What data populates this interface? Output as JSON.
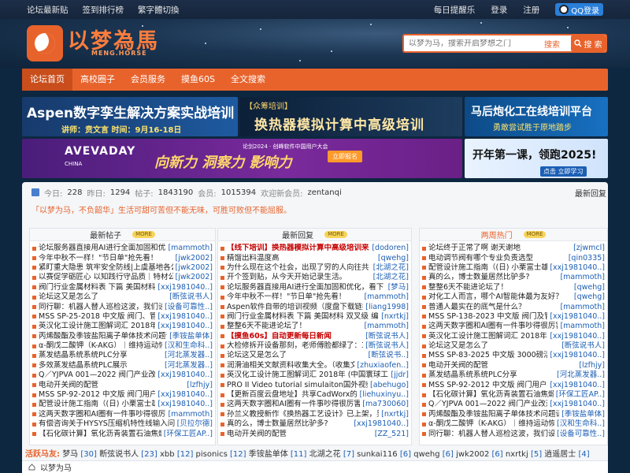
{
  "topbar": {
    "links": [
      "论坛最新贴",
      "签到排行榜",
      "繁字體切換"
    ],
    "daily": "每日提醒乐",
    "login": "登录",
    "register": "注册",
    "qq_login": "QQ登录"
  },
  "logo": {
    "title": "以梦為馬",
    "subtitle": "MENG.HORSE"
  },
  "search": {
    "placeholder": "以梦为马，搜索开启梦想之门",
    "label": "搜索",
    "button": "搜 索"
  },
  "nav": [
    "论坛首页",
    "高校圈子",
    "会员服务",
    "摸鱼60S",
    "全文搜索"
  ],
  "banners": {
    "b1_title": "Aspen数字孪生解决方案实战培训",
    "b1_sub": "讲师：贲文言    时间：9月16-18日",
    "b2_tag": "【众筹培训】",
    "b2_title": "换热器模拟计算中高级培训",
    "b3_title": "马后炮化工在线培训平台",
    "b3_sub": "勇敢尝试胜于原地踏步",
    "b4_brand": "AVEVADAY",
    "b4_brand_sub": "CHINA",
    "b4_event": "论剑2024 · 创峰软件中国用户大会",
    "b4_slogan": "向新力 洞察力 影响力",
    "b4_cta": "立即报名",
    "b5_title": "开年第一课，领跑2025!",
    "b5_cta": "点击 立即学习"
  },
  "stats": {
    "today_label": "今日:",
    "today": "228",
    "yesterday_label": "昨日:",
    "yesterday": "1294",
    "posts_label": "帖子:",
    "posts": "1843190",
    "members_label": "会员:",
    "members": "1015394",
    "welcome_label": "欢迎新会员:",
    "newest": "zentanqi",
    "latest_reply": "最新回复"
  },
  "slogan": "「以梦为马，不负韶华」生活可甜可苦但不能无味，可胜可败但不能屈服。",
  "more_label": "MORE",
  "col_latest": {
    "head": "最新帖子",
    "rows": [
      {
        "t": "论坛服务器直接用AI进行全面加固和优化，",
        "a": "[mammoth]"
      },
      {
        "t": "今年中秋不一样！\"节日单\"抢先看！",
        "a": "[jwk2002]"
      },
      {
        "t": "紧盯重大隐患 筑牢安全防线|上虞基地各公司",
        "a": "[jwk2002]"
      },
      {
        "t": "以赛促学砺匠心 以知践行守品质｜特材公司",
        "a": "[jwk2002]"
      },
      {
        "t": "阀门行业金属材料表 下篇 美国材料 双叉 双",
        "a": "[xxj1981040..]"
      },
      {
        "t": "论坛这又是怎么了",
        "a": "[断弦说书人]"
      },
      {
        "t": "同行聊：机器人替人巡检这波，我们设备",
        "a": "[设备可靠性..]"
      },
      {
        "t": "MSS SP-25-2018 中文版 阀门、管件、",
        "a": "[xxj1981040..]"
      },
      {
        "t": "英汉化工设计施工图解词汇 2018年 (中国",
        "a": "[xxj1981040..]"
      },
      {
        "t": "丙烯酸酯及季铵盐阳离子单体技术问题请",
        "a": "[季铵盐单体]"
      },
      {
        "t": "α-酮戊二酸钾（K-AKG）｜维持运动恢复",
        "a": "[汉和生命科..]"
      },
      {
        "t": "蒸发结晶系统系统PLC分享",
        "a": "[河北蒸发器..]"
      },
      {
        "t": "多效蒸发结晶系统PLC展示",
        "a": "[河北蒸发器..]"
      },
      {
        "t": "Q／YJPVA 001—2022 阀门产业改造提",
        "a": "[xxj1981040..]"
      },
      {
        "t": "电动开关阀的配管",
        "a": "[lzfhjy]"
      },
      {
        "t": "MSS SP-92-2012 中文版 阀门用户指南",
        "a": "[xxj1981040..]"
      },
      {
        "t": "配管设计施工指南（(日) 小栗富士雄",
        "a": "[xxj1981040..]"
      },
      {
        "t": "这两天数字圈和AI圈有一件事吵得很厉害",
        "a": "[mammoth]"
      },
      {
        "t": "有偿咨询关于HYSYS压缩机特性线输入问题",
        "a": "[贝拉尔德]"
      },
      {
        "t": "【石化碳计算】氧化沥青装置石油焦煅烧",
        "a": "[环保工匠AP..]"
      }
    ]
  },
  "col_reply": {
    "head": "最新回复",
    "rows": [
      {
        "t": "【线下培训】换热器模拟计算中高级培训来了",
        "a": "[dodoren]",
        "hl": true
      },
      {
        "t": "精馏出料温度高",
        "a": "[qwehg]"
      },
      {
        "t": "为什么现在这个社会，出现了穷的人向往共",
        "a": "[北湖之花]"
      },
      {
        "t": "开个签到贴，从今天开始记录生活。",
        "a": "[北湖之花]"
      },
      {
        "t": "论坛服务器直接用AI进行全面加固和优化，看下",
        "a": "[梦马]"
      },
      {
        "t": "今年中秋不一样！\"节日单\"抢先看！",
        "a": "[mammoth]"
      },
      {
        "t": "Aspen软件自带的培训视频（度盘下载链接",
        "a": "[liang1998]"
      },
      {
        "t": "阀门行业金属材料表 下篇 美国材料 双叉级 编制",
        "a": "[nxrtkj]"
      },
      {
        "t": "整整6天不能进论坛了！",
        "a": "[mammoth]"
      },
      {
        "t": "【摸鱼60s】自动更新每日新闻",
        "a": "[断弦说书人]",
        "hl": true
      },
      {
        "t": "大检修拆开设备那刻，老师傅脸都绿了：3",
        "a": "[断弦说书人]"
      },
      {
        "t": "论坛这又是怎么了",
        "a": "[断弦说书..]"
      },
      {
        "t": "润滑油相关文献资料收集大全。（收集文",
        "a": "[zhuxiaofen..]"
      },
      {
        "t": "英汉化工设计施工图解词汇 2018年 (中国寰球工程",
        "a": "[jjdr]"
      },
      {
        "t": "PRO II Video tutorial simulaiton国外视频教程",
        "a": "[abehugo]"
      },
      {
        "t": "【更新百度云盘地址】共享CadWorx的GB",
        "a": "[liehuxinyu..]"
      },
      {
        "t": "这两天数字圈和AI圈有一件事吵得很厉害",
        "a": "[ma730060]"
      },
      {
        "t": "孙兰义教授新作《换热器工艺设计》已上架，另",
        "a": "[nxrtkj]"
      },
      {
        "t": "真的么，博士数量居然比驴多?",
        "a": "[xxj1981040..]"
      },
      {
        "t": "电动开关阀的配管",
        "a": "[ZZ_521]"
      }
    ]
  },
  "col_hot": {
    "head": "两周热门",
    "rows": [
      {
        "t": "论坛终于正常了啊 谢天谢地",
        "a": "[zjwmcl]"
      },
      {
        "t": "电动调节阀有哪个专业负责选型",
        "a": "[qin0335]"
      },
      {
        "t": "配管设计施工指南（(日) 小栗富士雄",
        "a": "[xxj1981040..]"
      },
      {
        "t": "真的么，博士数量居然比驴多?",
        "a": "[mammoth]"
      },
      {
        "t": "整整6天不能进论坛了！",
        "a": "[qwehg]"
      },
      {
        "t": "对化工人而言，哪个AI智能体最为友好？",
        "a": "[qwehg]"
      },
      {
        "t": "普通人最实在的底气是什么？",
        "a": "[mammoth]"
      },
      {
        "t": "MSS SP-138-2023 中文版 阀门及管件氧",
        "a": "[xxj1981040..]"
      },
      {
        "t": "这两天数字圈和AI圈有一件事吵得很厉害",
        "a": "[mammoth]"
      },
      {
        "t": "英汉化工设计施工图解词汇 2018年 (中国",
        "a": "[xxj1981040..]"
      },
      {
        "t": "论坛这又是怎么了",
        "a": "[断弦说书人]"
      },
      {
        "t": "MSS SP-83-2025 中文版 3000磅活与",
        "a": "[xxj1981040..]"
      },
      {
        "t": "电动开关阀的配管",
        "a": "[lzfhjy]"
      },
      {
        "t": "蒸发结晶系统系统PLC分享",
        "a": "[河北蒸发器..]"
      },
      {
        "t": "MSS SP-92-2012 中文版 阀门用户指南",
        "a": "[xxj1981040..]"
      },
      {
        "t": "【石化碳计算】氧化沥青装置石油焦煅烧",
        "a": "[环保工匠AP..]"
      },
      {
        "t": "Q／YJPVA 001—2022 阀门产业改造提",
        "a": "[xxj1981040..]"
      },
      {
        "t": "丙烯酸酯及季铵盐阳离子单体技术问题请",
        "a": "[季铵盐单体]"
      },
      {
        "t": "α-酮戊二酸钾（K-AKG）｜维持运动恢复",
        "a": "[汉和生命科..]"
      },
      {
        "t": "同行聊：机器人替人巡检这波，我们设备",
        "a": "[设备可靠性..]"
      }
    ]
  },
  "active": {
    "label": "活跃马友:",
    "users": [
      {
        "n": "梦马",
        "c": "[30]"
      },
      {
        "n": "断弦说书人",
        "c": "[23]"
      },
      {
        "n": "xbb",
        "c": "[12]"
      },
      {
        "n": "pisonics",
        "c": "[12]"
      },
      {
        "n": "季铵盐单体",
        "c": "[11]"
      },
      {
        "n": "北湖之花",
        "c": "[7]"
      },
      {
        "n": "sunkai116",
        "c": "[6]"
      },
      {
        "n": "qwehg",
        "c": "[6]"
      },
      {
        "n": "jwk2002",
        "c": "[6]"
      },
      {
        "n": "nxrtkj",
        "c": "[5]"
      },
      {
        "n": "逍遥居士",
        "c": "[4]"
      }
    ]
  },
  "bottom": {
    "crumb": "以梦为马"
  }
}
